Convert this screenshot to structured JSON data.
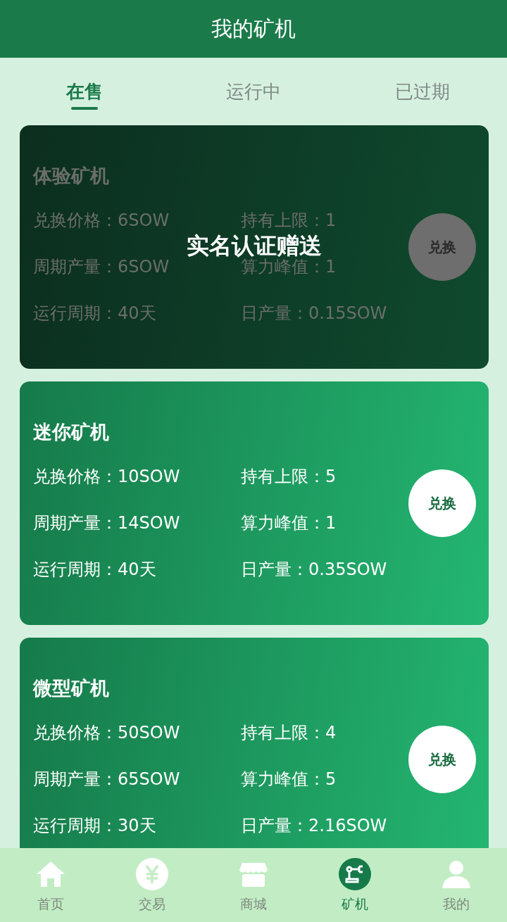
{
  "header": {
    "title": "我的矿机"
  },
  "tabs": [
    {
      "label": "在售",
      "selected": true
    },
    {
      "label": "运行中",
      "selected": false
    },
    {
      "label": "已过期",
      "selected": false
    }
  ],
  "cards": [
    {
      "name": "体验矿机",
      "disabled": true,
      "overlay_note": "实名认证赠送",
      "stats": [
        "兑换价格：6SOW",
        "持有上限：1",
        "周期产量：6SOW",
        "算力峰值：1",
        "运行周期：40天",
        "日产量：0.15SOW"
      ],
      "button": "兑换"
    },
    {
      "name": "迷你矿机",
      "disabled": false,
      "stats": [
        "兑换价格：10SOW",
        "持有上限：5",
        "周期产量：14SOW",
        "算力峰值：1",
        "运行周期：40天",
        "日产量：0.35SOW"
      ],
      "button": "兑换"
    },
    {
      "name": "微型矿机",
      "disabled": false,
      "stats": [
        "兑换价格：50SOW",
        "持有上限：4",
        "周期产量：65SOW",
        "算力峰值：5",
        "运行周期：30天",
        "日产量：2.16SOW"
      ],
      "button": "兑换"
    }
  ],
  "bottom_nav": [
    {
      "kind": "home",
      "label": "首页",
      "selected": false
    },
    {
      "kind": "trade",
      "label": "交易",
      "selected": false
    },
    {
      "kind": "shop",
      "label": "商城",
      "selected": false
    },
    {
      "kind": "miner",
      "label": "矿机",
      "selected": true
    },
    {
      "kind": "profile",
      "label": "我的",
      "selected": false
    }
  ]
}
